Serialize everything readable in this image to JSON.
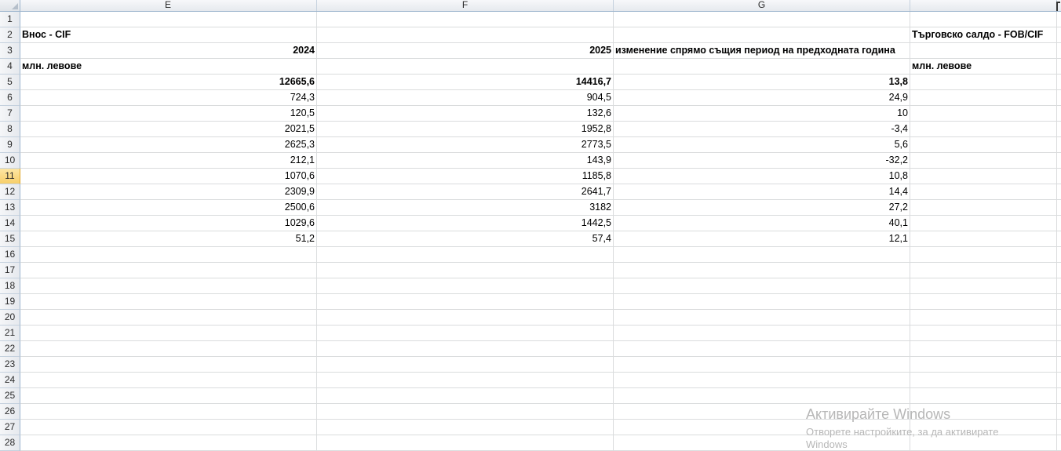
{
  "columns": [
    "E",
    "F",
    "G",
    "",
    ""
  ],
  "active_row": "11",
  "rows": [
    {
      "n": "1",
      "E": "",
      "F": "",
      "G": "",
      "H": ""
    },
    {
      "n": "2",
      "E": "Внос - CIF",
      "F": "",
      "G": "",
      "H": "Търговско салдо - FOB/CIF"
    },
    {
      "n": "3",
      "E": "2024",
      "F": "2025",
      "G": "изменение спрямо същия период на предходната година",
      "H": ""
    },
    {
      "n": "4",
      "E": "млн. левове",
      "F": "",
      "G": "",
      "H": "млн. левове"
    },
    {
      "n": "5",
      "E": "12665,6",
      "F": "14416,7",
      "G": "13,8",
      "H": ""
    },
    {
      "n": "6",
      "E": "724,3",
      "F": "904,5",
      "G": "24,9",
      "H": ""
    },
    {
      "n": "7",
      "E": "120,5",
      "F": "132,6",
      "G": "10",
      "H": ""
    },
    {
      "n": "8",
      "E": "2021,5",
      "F": "1952,8",
      "G": "-3,4",
      "H": ""
    },
    {
      "n": "9",
      "E": "2625,3",
      "F": "2773,5",
      "G": "5,6",
      "H": ""
    },
    {
      "n": "10",
      "E": "212,1",
      "F": "143,9",
      "G": "-32,2",
      "H": ""
    },
    {
      "n": "11",
      "E": "1070,6",
      "F": "1185,8",
      "G": "10,8",
      "H": ""
    },
    {
      "n": "12",
      "E": "2309,9",
      "F": "2641,7",
      "G": "14,4",
      "H": ""
    },
    {
      "n": "13",
      "E": "2500,6",
      "F": "3182",
      "G": "27,2",
      "H": ""
    },
    {
      "n": "14",
      "E": "1029,6",
      "F": "1442,5",
      "G": "40,1",
      "H": ""
    },
    {
      "n": "15",
      "E": "51,2",
      "F": "57,4",
      "G": "12,1",
      "H": ""
    },
    {
      "n": "16",
      "E": "",
      "F": "",
      "G": "",
      "H": ""
    },
    {
      "n": "17",
      "E": "",
      "F": "",
      "G": "",
      "H": ""
    },
    {
      "n": "18",
      "E": "",
      "F": "",
      "G": "",
      "H": ""
    },
    {
      "n": "19",
      "E": "",
      "F": "",
      "G": "",
      "H": ""
    },
    {
      "n": "20",
      "E": "",
      "F": "",
      "G": "",
      "H": ""
    },
    {
      "n": "21",
      "E": "",
      "F": "",
      "G": "",
      "H": ""
    },
    {
      "n": "22",
      "E": "",
      "F": "",
      "G": "",
      "H": ""
    },
    {
      "n": "23",
      "E": "",
      "F": "",
      "G": "",
      "H": ""
    },
    {
      "n": "24",
      "E": "",
      "F": "",
      "G": "",
      "H": ""
    },
    {
      "n": "25",
      "E": "",
      "F": "",
      "G": "",
      "H": ""
    },
    {
      "n": "26",
      "E": "",
      "F": "",
      "G": "",
      "H": ""
    },
    {
      "n": "27",
      "E": "",
      "F": "",
      "G": "",
      "H": ""
    },
    {
      "n": "28",
      "E": "",
      "F": "",
      "G": "",
      "H": ""
    }
  ],
  "watermark": {
    "title": "Активирайте Windows",
    "subtitle": "Отворете настройките, за да активирате",
    "subtitle2": "Windows"
  }
}
